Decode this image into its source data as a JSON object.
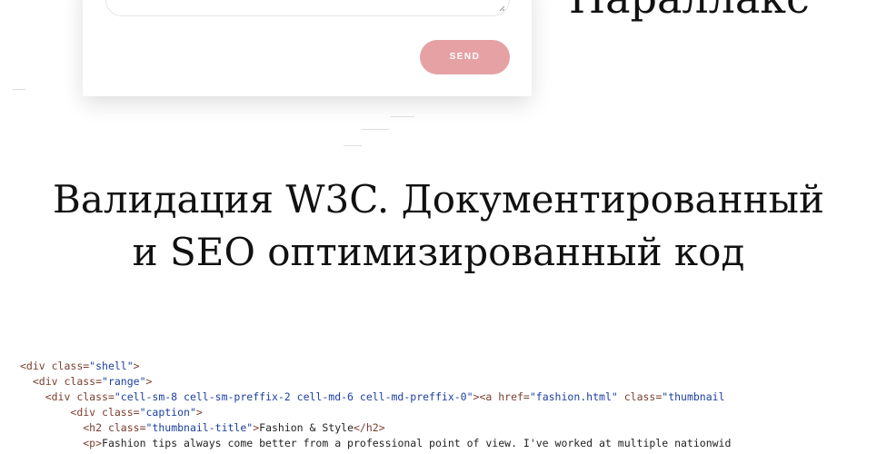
{
  "form": {
    "send_label": "SEND"
  },
  "parallax_title": "Параллакс",
  "section": {
    "heading_line1": "Валидация W3C. Документированный",
    "heading_line2": "и SEO оптимизированный код"
  },
  "code": {
    "lines": [
      {
        "indent": "",
        "parts": [
          {
            "t": "tag",
            "v": "<div "
          },
          {
            "t": "attr",
            "v": "class="
          },
          {
            "t": "str",
            "v": "\"shell\""
          },
          {
            "t": "tag",
            "v": ">"
          }
        ]
      },
      {
        "indent": "  ",
        "parts": [
          {
            "t": "tag",
            "v": "<div "
          },
          {
            "t": "attr",
            "v": "class="
          },
          {
            "t": "str",
            "v": "\"range\""
          },
          {
            "t": "tag",
            "v": ">"
          }
        ]
      },
      {
        "indent": "    ",
        "parts": [
          {
            "t": "tag",
            "v": "<div "
          },
          {
            "t": "attr",
            "v": "class="
          },
          {
            "t": "str",
            "v": "\"cell-sm-8 cell-sm-preffix-2 cell-md-6 cell-md-preffix-0\""
          },
          {
            "t": "tag",
            "v": "><a "
          },
          {
            "t": "attr",
            "v": "href="
          },
          {
            "t": "str",
            "v": "\"fashion.html\""
          },
          {
            "t": "attr",
            "v": " class="
          },
          {
            "t": "str",
            "v": "\"thumbnail"
          }
        ]
      },
      {
        "indent": "        ",
        "parts": [
          {
            "t": "tag",
            "v": "<div "
          },
          {
            "t": "attr",
            "v": "class="
          },
          {
            "t": "str",
            "v": "\"caption\""
          },
          {
            "t": "tag",
            "v": ">"
          }
        ]
      },
      {
        "indent": "          ",
        "parts": [
          {
            "t": "tag",
            "v": "<h2 "
          },
          {
            "t": "attr",
            "v": "class="
          },
          {
            "t": "str",
            "v": "\"thumbnail-title\""
          },
          {
            "t": "tag",
            "v": ">"
          },
          {
            "t": "txt",
            "v": "Fashion & Style"
          },
          {
            "t": "tag",
            "v": "</h2>"
          }
        ]
      },
      {
        "indent": "          ",
        "parts": [
          {
            "t": "tag",
            "v": "<p>"
          },
          {
            "t": "txt",
            "v": "Fashion tips always come better from a professional point of view. I've worked at multiple nationwid"
          }
        ]
      }
    ]
  }
}
